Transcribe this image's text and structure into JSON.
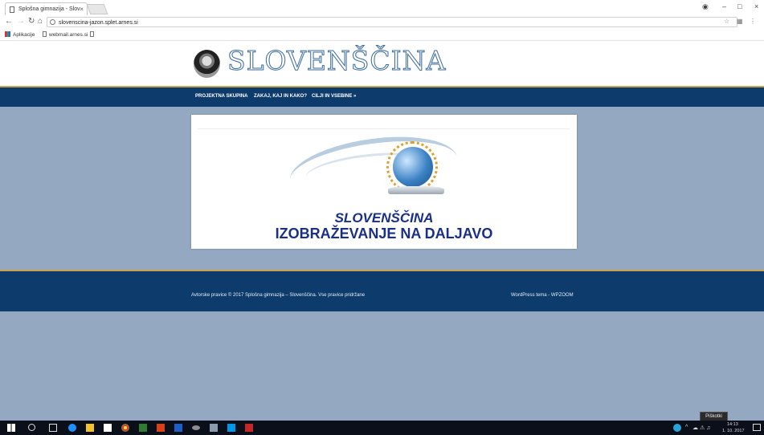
{
  "browser": {
    "tab_title": "Splošna gimnazija - Slov",
    "tab_close": "×",
    "url": "slovenscina-jazon.splet.arnes.si",
    "bookmarks": [
      "Aplikacije",
      "webmail.arnes.si"
    ]
  },
  "site": {
    "title": "SLOVENŠČINA",
    "nav": [
      "PROJEKTNA SKUPINA",
      "ZAKAJ, KAJ IN KAKO?",
      "CILJI IN VSEBINE »"
    ],
    "banner": {
      "line1": "SLOVENŠČINA",
      "line2": "IZOBRAŽEVANJE NA DALJAVO"
    },
    "footer": {
      "copyright": "Avtorske pravice © 2017 Splošna gimnazija – Slovenščina. Vse pravice pridržane",
      "theme": "WordPress tema - WPZOOM"
    }
  },
  "tooltip": "Piškotki",
  "taskbar": {
    "time": "14:13",
    "date": "1. 10. 2017"
  },
  "colors": {
    "page_bg": "#94a9c1",
    "navbar": "#0d3b6b",
    "accent_gold": "#c9a44a",
    "banner_text": "#1a2f86"
  }
}
